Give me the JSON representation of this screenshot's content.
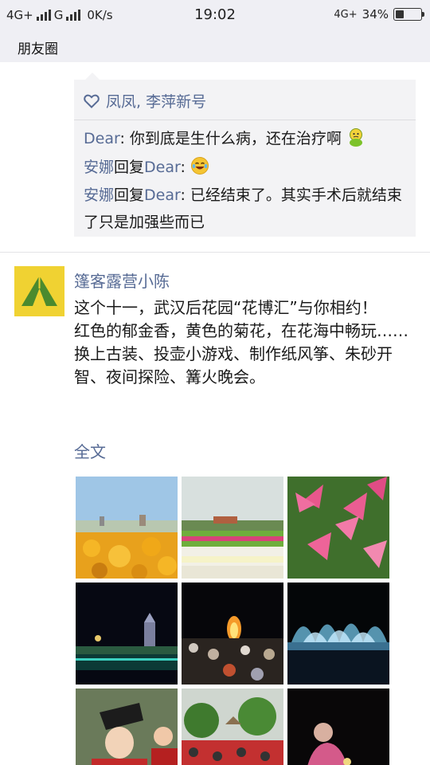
{
  "status_bar": {
    "network_1": "4G+",
    "network_2": "G",
    "speed": "0K/s",
    "time": "19:02",
    "network_3": "4G+",
    "battery_text": "34%",
    "battery_level": 0.34
  },
  "header": {
    "title": "朋友圈"
  },
  "likes": {
    "icon": "heart-icon",
    "names": "凤凤, 李萍新号"
  },
  "comments": [
    {
      "author": "Dear",
      "reply_word": "",
      "reply_to": "",
      "text": ": 你到底是生什么病，还在治疗啊",
      "emoji": "green-face-emoji"
    },
    {
      "author": "安娜",
      "reply_word": "回复",
      "reply_to": "Dear",
      "text": ": ",
      "emoji": "laugh-tears-emoji"
    },
    {
      "author": "安娜",
      "reply_word": "回复",
      "reply_to": "Dear",
      "text": ": 已经结束了。其实手术后就结束了只是加强些而已",
      "emoji": ""
    }
  ],
  "post": {
    "author": "篷客露营小陈",
    "avatar_icon": "tent-logo-icon",
    "text_lines": [
      "这个十一，武汉后花园“花博汇”与你相约！",
      "红色的郁金香，黄色的菊花，在花海中畅玩……",
      "换上古装、投壶小游戏、制作纸风筝、朱砂开智、夜间探险、篝火晚会。"
    ],
    "full_text_link": "全文",
    "photos": [
      "yellow-lily-field-photo",
      "flower-garden-photo",
      "pink-lily-photo",
      "night-castle-photo",
      "bonfire-crowd-photo",
      "fountain-show-photo",
      "child-costume-photo",
      "crowd-under-trees-photo",
      "night-girl-photo"
    ]
  },
  "colors": {
    "link": "#576b95",
    "background": "#ffffff",
    "comment_bg": "#f3f3f5",
    "avatar_bg": "#f0d232",
    "tent_green": "#4b8a2e"
  }
}
